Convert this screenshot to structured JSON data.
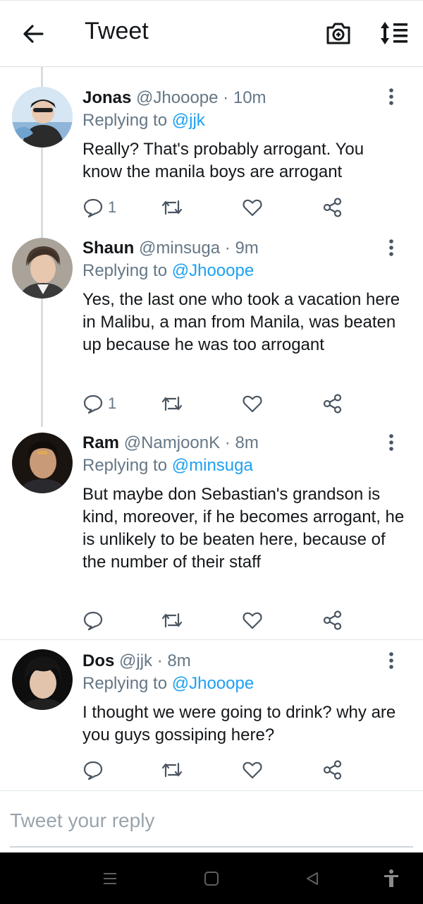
{
  "header": {
    "title": "Tweet",
    "back_icon": "arrow-left-icon",
    "camera_icon": "camera-plus-icon",
    "sort_icon": "sort-list-icon"
  },
  "tweets": [
    {
      "name": "Jonas",
      "handle": "@Jhooope",
      "separator": "·",
      "time": "10m",
      "replying_prefix": "Replying to",
      "replying_to": "@jjk",
      "text": "Really? That's probably arrogant. You know the manila boys are arrogant",
      "reply_count": "1"
    },
    {
      "name": "Shaun",
      "handle": "@minsuga",
      "separator": "·",
      "time": "9m",
      "replying_prefix": "Replying to",
      "replying_to": "@Jhooope",
      "text": "Yes, the last one who took a vacation here in Malibu, a man from Manila, was beaten up because he was too arrogant",
      "reply_count": "1"
    },
    {
      "name": "Ram",
      "handle": "@NamjoonK",
      "separator": "·",
      "time": "8m",
      "replying_prefix": "Replying to",
      "replying_to": "@minsuga",
      "text": "But maybe don Sebastian's grandson is kind, moreover, if he becomes arrogant, he is unlikely to be beaten here, because of the number of their staff",
      "reply_count": ""
    },
    {
      "name": "Dos",
      "handle": "@jjk",
      "separator": "·",
      "time": "8m",
      "replying_prefix": "Replying to",
      "replying_to": "@Jhooope",
      "text": "I thought we were going to drink? why are you guys gossiping here?",
      "reply_count": ""
    }
  ],
  "reply_box": {
    "placeholder": "Tweet your reply"
  },
  "colors": {
    "accent": "#1da1f2",
    "secondary_text": "#657786",
    "action_icon": "#4a5561",
    "navbar": "#000000"
  }
}
